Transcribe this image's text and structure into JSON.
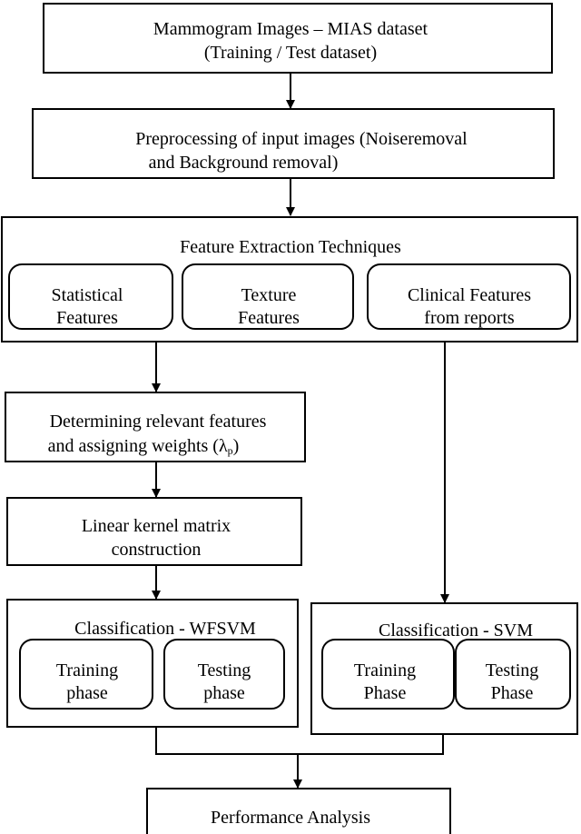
{
  "nodes": {
    "input": {
      "line1": "Mammogram Images – MIAS dataset",
      "line2": "(Training / Test dataset)"
    },
    "preprocess": {
      "line1": "Preprocessing of input images (Noiseremoval",
      "line2": "and Background removal)"
    },
    "feature_extraction": {
      "title": "Feature Extraction Techniques",
      "items": [
        {
          "line1": "Statistical",
          "line2": "Features"
        },
        {
          "line1": "Texture",
          "line2": "Features"
        },
        {
          "line1": "Clinical Features",
          "line2": "from reports"
        }
      ]
    },
    "weights": {
      "line1": "Determining relevant features",
      "line2": "and assigning weights (λ",
      "sub": "p",
      "close": ")"
    },
    "kernel": {
      "line1": "Linear kernel matrix",
      "line2": "construction"
    },
    "wfsvm": {
      "title": "Classification - WFSVM",
      "items": [
        {
          "line1": "Training",
          "line2": "phase"
        },
        {
          "line1": "Testing",
          "line2": "phase"
        }
      ]
    },
    "svm": {
      "title": "Classification - SVM",
      "items": [
        {
          "line1": "Training",
          "line2": "Phase"
        },
        {
          "line1": "Testing",
          "line2": "Phase"
        }
      ]
    },
    "performance": {
      "label": "Performance Analysis"
    }
  }
}
